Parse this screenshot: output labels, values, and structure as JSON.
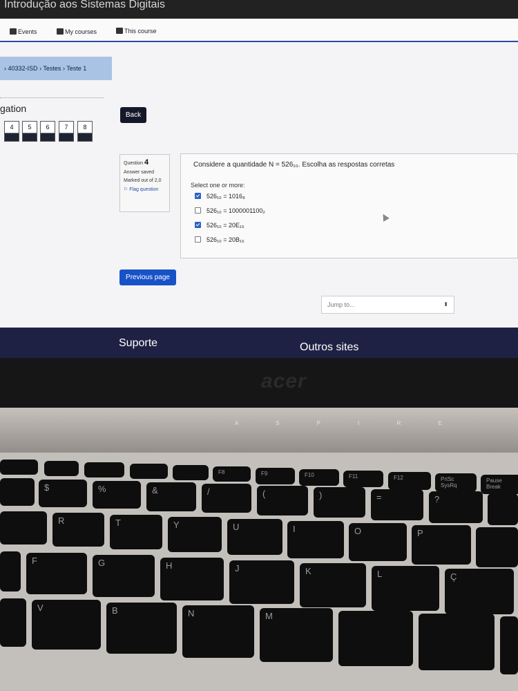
{
  "window_title": "Introdução aos Sistemas Digitais",
  "topnav": {
    "events": "Events",
    "my_courses": "My courses",
    "this_course": "This course"
  },
  "breadcrumb": {
    "course": "40332-ISD",
    "section": "Testes",
    "page": "Teste 1"
  },
  "quiz_nav": {
    "title": "gation",
    "buttons": [
      "4",
      "5",
      "6",
      "7",
      "8"
    ]
  },
  "back_label": "Back",
  "question_info": {
    "label": "Question",
    "number": "4",
    "state": "Answer saved",
    "mark": "Marked out of 2,0",
    "flag": "Flag question"
  },
  "question": {
    "prompt": "Considere a quantidade N = 526₁₀. Escolha as respostas corretas",
    "select_label": "Select one or more:",
    "options": [
      {
        "text": "526₁₀ = 1016₈",
        "checked": true
      },
      {
        "text": "526₁₀ = 1000001100₂",
        "checked": false
      },
      {
        "text": "526₁₀ = 20E₁₆",
        "checked": true
      },
      {
        "text": "526₁₀ = 20B₁₆",
        "checked": false
      }
    ]
  },
  "previous_label": "Previous page",
  "jump_placeholder": "Jump to...",
  "footer": {
    "left": "Suporte",
    "right": "Outros sites"
  },
  "laptop": {
    "brand": "acer",
    "model": "A S P I R E",
    "fkeys": [
      "F8",
      "F9",
      "F10",
      "F11",
      "F12",
      "PrtSc SysRq",
      "Pause Break"
    ],
    "row_numbers": [
      "$",
      "%",
      "&",
      "/",
      "(",
      ")",
      "=",
      "?"
    ],
    "row_top": [
      "R",
      "T",
      "Y",
      "U",
      "I",
      "O",
      "P"
    ],
    "row_home": [
      "F",
      "G",
      "H",
      "J",
      "K",
      "L",
      "Ç"
    ],
    "row_bottom": [
      "V",
      "B",
      "N",
      "M"
    ]
  }
}
